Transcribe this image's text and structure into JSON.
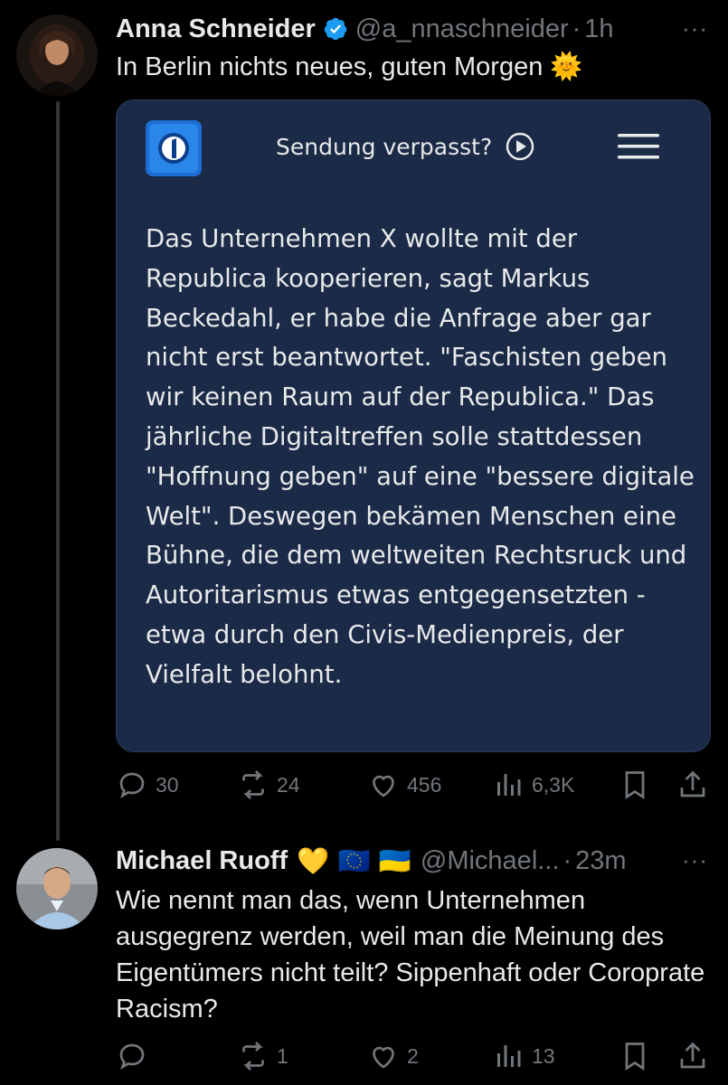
{
  "tweet1": {
    "author_name": "Anna Schneider",
    "handle": "@a_nnaschneider",
    "separator": "·",
    "time": "1h",
    "more": "···",
    "text": "In Berlin nichts neues, guten Morgen 🌞",
    "card": {
      "title": "Sendung verpasst?",
      "body": "Das Unternehmen X wollte mit der Republica kooperieren, sagt Markus Beckedahl, er habe die Anfrage aber gar nicht erst beantwortet. \"Faschisten geben wir keinen Raum auf der Republica.\" Das jährliche Digitaltreffen solle stattdessen \"Hoffnung geben\" auf eine \"bessere digitale Welt\". Deswegen bekämen Menschen eine Bühne, die dem weltweiten Rechtsruck und Autoritarismus etwas entgegensetzten - etwa durch den Civis-Medienpreis, der Vielfalt belohnt."
    },
    "actions": {
      "replies": "30",
      "reposts": "24",
      "likes": "456",
      "views": "6,3K"
    }
  },
  "tweet2": {
    "author_name": "Michael Ruoff",
    "emojis": "💛 🇪🇺 🇺🇦",
    "handle": "@Michael...",
    "separator": "·",
    "time": "23m",
    "more": "···",
    "text": "Wie nennt man das, wenn Unternehmen ausgegrenz werden, weil man die Meinung des Eigentümers nicht teilt? Sippenhaft oder Coroprate Racism?",
    "actions": {
      "replies": "",
      "reposts": "1",
      "likes": "2",
      "views": "13"
    }
  },
  "colors": {
    "background": "#000000",
    "text": "#e7e9ea",
    "muted": "#71767b",
    "verified": "#1d9bf0",
    "card_bg": "#1b2a47"
  }
}
